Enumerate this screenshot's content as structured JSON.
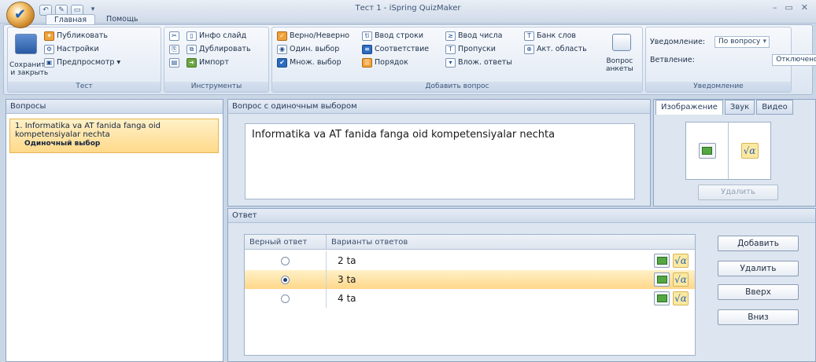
{
  "app": {
    "title": "Тест 1 - iSpring QuizMaker",
    "window_controls": [
      "–",
      "▭",
      "✕"
    ]
  },
  "ribbon_tabs": [
    "Главная",
    "Помощь"
  ],
  "ribbon": {
    "test_group": {
      "label": "Тест",
      "save_close": "Сохранить\nи закрыть",
      "publish": "Публиковать",
      "settings": "Настройки",
      "preview": "Предпросмотр"
    },
    "tools_group": {
      "label": "Инструменты",
      "info_slide": "Инфо слайд",
      "duplicate": "Дублировать",
      "import": "Импорт"
    },
    "add_group": {
      "label": "Добавить вопрос",
      "true_false": "Верно/Неверно",
      "single_choice": "Один. выбор",
      "multi_choice": "Множ. выбор",
      "string_input": "Ввод строки",
      "matching": "Соответствие",
      "order": "Порядок",
      "number_input": "Ввод числа",
      "gaps": "Пропуски",
      "nested": "Влож. ответы",
      "word_bank": "Банк слов",
      "hotspot": "Акт. область",
      "survey": "Вопрос\nанкеты"
    },
    "notify_group": {
      "label": "Уведомление",
      "notify_label": "Уведомление:",
      "notify_value": "По вопросу",
      "branch_label": "Ветвление:",
      "branch_value": "Отключено"
    }
  },
  "questions_panel": {
    "title": "Вопросы",
    "items": [
      {
        "num": "1.",
        "text": "Informatika va AT fanida fanga oid kompetensiyalar nechta",
        "type": "Одиночный выбор"
      }
    ]
  },
  "question_panel": {
    "title": "Вопрос с одиночным выбором",
    "text": "Informatika va AT fanida fanga oid kompetensiyalar nechta"
  },
  "media_panel": {
    "tabs": [
      "Изображение",
      "Звук",
      "Видео"
    ],
    "delete": "Удалить"
  },
  "answer_panel": {
    "title": "Ответ",
    "col_correct": "Верный ответ",
    "col_options": "Варианты ответов",
    "rows": [
      {
        "text": "2 ta",
        "correct": false
      },
      {
        "text": "3 ta",
        "correct": true
      },
      {
        "text": "4 ta",
        "correct": false
      }
    ],
    "buttons": {
      "add": "Добавить",
      "delete": "Удалить",
      "up": "Вверх",
      "down": "Вниз"
    }
  }
}
